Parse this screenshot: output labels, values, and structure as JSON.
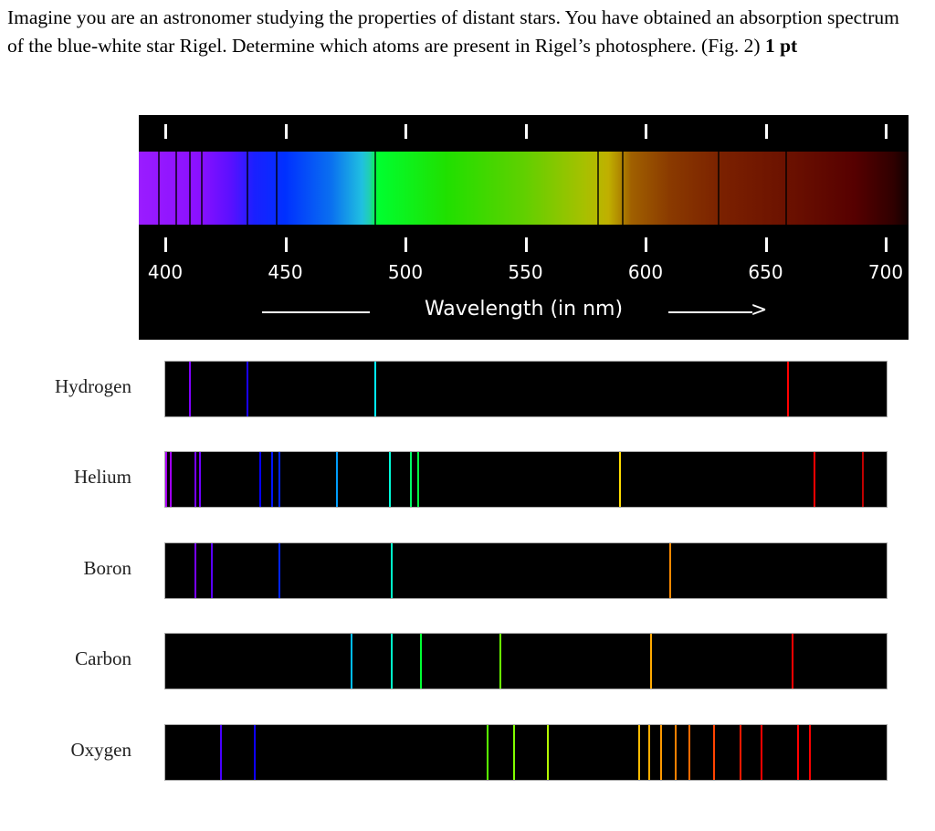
{
  "question": {
    "text": "Imagine you are an astronomer studying the properties of distant stars. You have obtained an absorption spectrum of the blue-white star Rigel. Determine which atoms are present in Rigel’s photosphere. (Fig. 2)",
    "points": "1 pt"
  },
  "figure": {
    "tick_labels": [
      "400",
      "450",
      "500",
      "550",
      "600",
      "650",
      "700"
    ],
    "axis_label": "Wavelength (in nm)",
    "arrow_head": ">",
    "rigel_absorption_lines_nm": [
      397,
      404,
      410,
      415,
      434,
      446,
      487,
      580,
      590,
      630,
      658
    ],
    "elements": [
      {
        "name": "Hydrogen",
        "lines_nm": [
          410,
          434,
          487,
          659
        ]
      },
      {
        "name": "Helium",
        "lines_nm": [
          400,
          402,
          412,
          414,
          439,
          444,
          447,
          471,
          493,
          502,
          505,
          589,
          670,
          690
        ]
      },
      {
        "name": "Boron",
        "lines_nm": [
          412,
          419,
          447,
          494,
          610
        ]
      },
      {
        "name": "Carbon",
        "lines_nm": [
          477,
          494,
          506,
          539,
          602,
          661
        ]
      },
      {
        "name": "Oxygen",
        "lines_nm": [
          423,
          437,
          534,
          545,
          559,
          597,
          601,
          606,
          612,
          618,
          628,
          639,
          648,
          663,
          668
        ]
      }
    ]
  }
}
